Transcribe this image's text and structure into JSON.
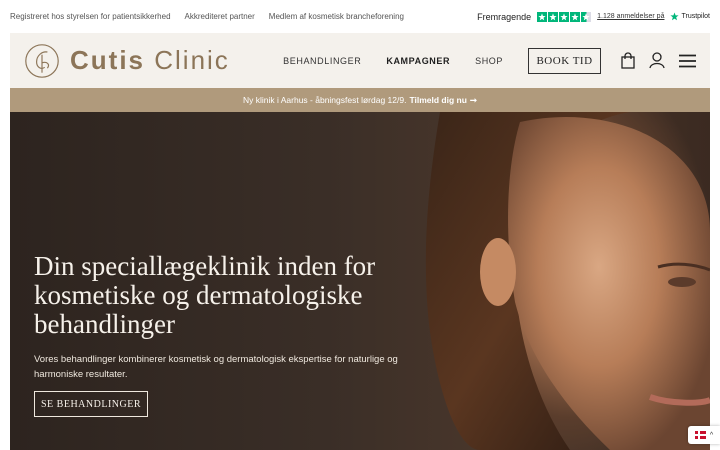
{
  "topbar": {
    "links": [
      "Registreret hos styrelsen for patientsikkerhed",
      "Akkrediteret partner",
      "Medlem af kosmetisk brancheforening"
    ],
    "trustpilot": {
      "rating_label": "Fremragende",
      "stars": 4.5,
      "reviews_link": "1.128 anmeldelser på",
      "brand": "Trustpilot"
    }
  },
  "header": {
    "logo_bold": "Cutis",
    "logo_light": "Clinic",
    "nav": [
      {
        "label": "BEHANDLINGER",
        "active": false
      },
      {
        "label": "KAMPAGNER",
        "active": true
      },
      {
        "label": "SHOP",
        "active": false
      }
    ],
    "book_label": "BOOK TID",
    "icons": [
      "shopping-bag-icon",
      "user-icon",
      "menu-icon"
    ]
  },
  "announcement": {
    "text": "Ny klinik i Aarhus - åbningsfest lørdag 12/9.",
    "link": "Tilmeld dig nu",
    "arrow": "➞"
  },
  "hero": {
    "title": "Din speciallægeklinik inden for kosmetiske og dermatologiske behandlinger",
    "subtitle": "Vores behandlinger kombinerer kosmetisk og dermatologisk ekspertise for naturlige og harmoniske resultater.",
    "cta_label": "SE BEHANDLINGER"
  },
  "language": {
    "flag": "denmark-flag",
    "chevron": "^"
  },
  "colors": {
    "accent": "#b09a7c",
    "logo": "#8c7558",
    "trustpilot_green": "#00b67a",
    "header_bg": "#f4f1ec"
  }
}
